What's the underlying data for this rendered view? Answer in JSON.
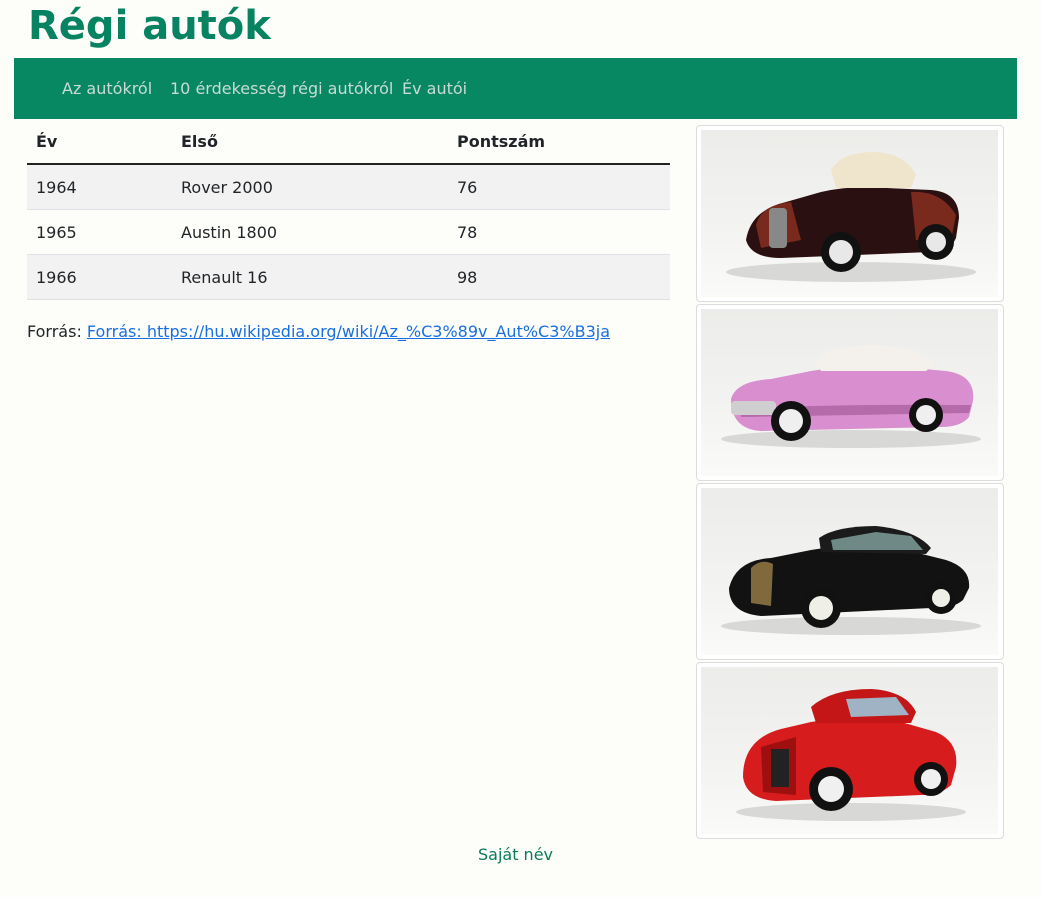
{
  "page": {
    "title": "Régi autók"
  },
  "nav": {
    "items": [
      {
        "label": "Az autókról"
      },
      {
        "label": "10 érdekesség régi autókról"
      },
      {
        "label": "Év autói"
      }
    ]
  },
  "table": {
    "headers": [
      "Év",
      "Első",
      "Pontszám"
    ],
    "rows": [
      [
        "1964",
        "Rover 2000",
        "76"
      ],
      [
        "1965",
        "Austin 1800",
        "78"
      ],
      [
        "1966",
        "Renault 16",
        "98"
      ]
    ]
  },
  "source": {
    "label": "Forrás:",
    "link_text": "Forrás: https://hu.wikipedia.org/wiki/Az_%C3%89v_Aut%C3%B3ja"
  },
  "gallery": {
    "images": [
      {
        "name": "dark-red-roadster",
        "body_color": "#2a1010",
        "accent_color": "#7a2a1c",
        "roof_color": "#efe4cc"
      },
      {
        "name": "pink-convertible",
        "body_color": "#d98fcf",
        "accent_color": "#b56aa9",
        "roof_color": "#f4f1ec"
      },
      {
        "name": "black-coupe",
        "body_color": "#121212",
        "accent_color": "#c9a45a",
        "roof_color": "#1b1b1b"
      },
      {
        "name": "red-coupe",
        "body_color": "#d61c1c",
        "accent_color": "#9e0f0f",
        "roof_color": "#c41616"
      }
    ]
  },
  "footer": {
    "text": "Saját név"
  },
  "colors": {
    "brand": "#088763",
    "title": "#088362",
    "link": "#1a6fe0"
  }
}
